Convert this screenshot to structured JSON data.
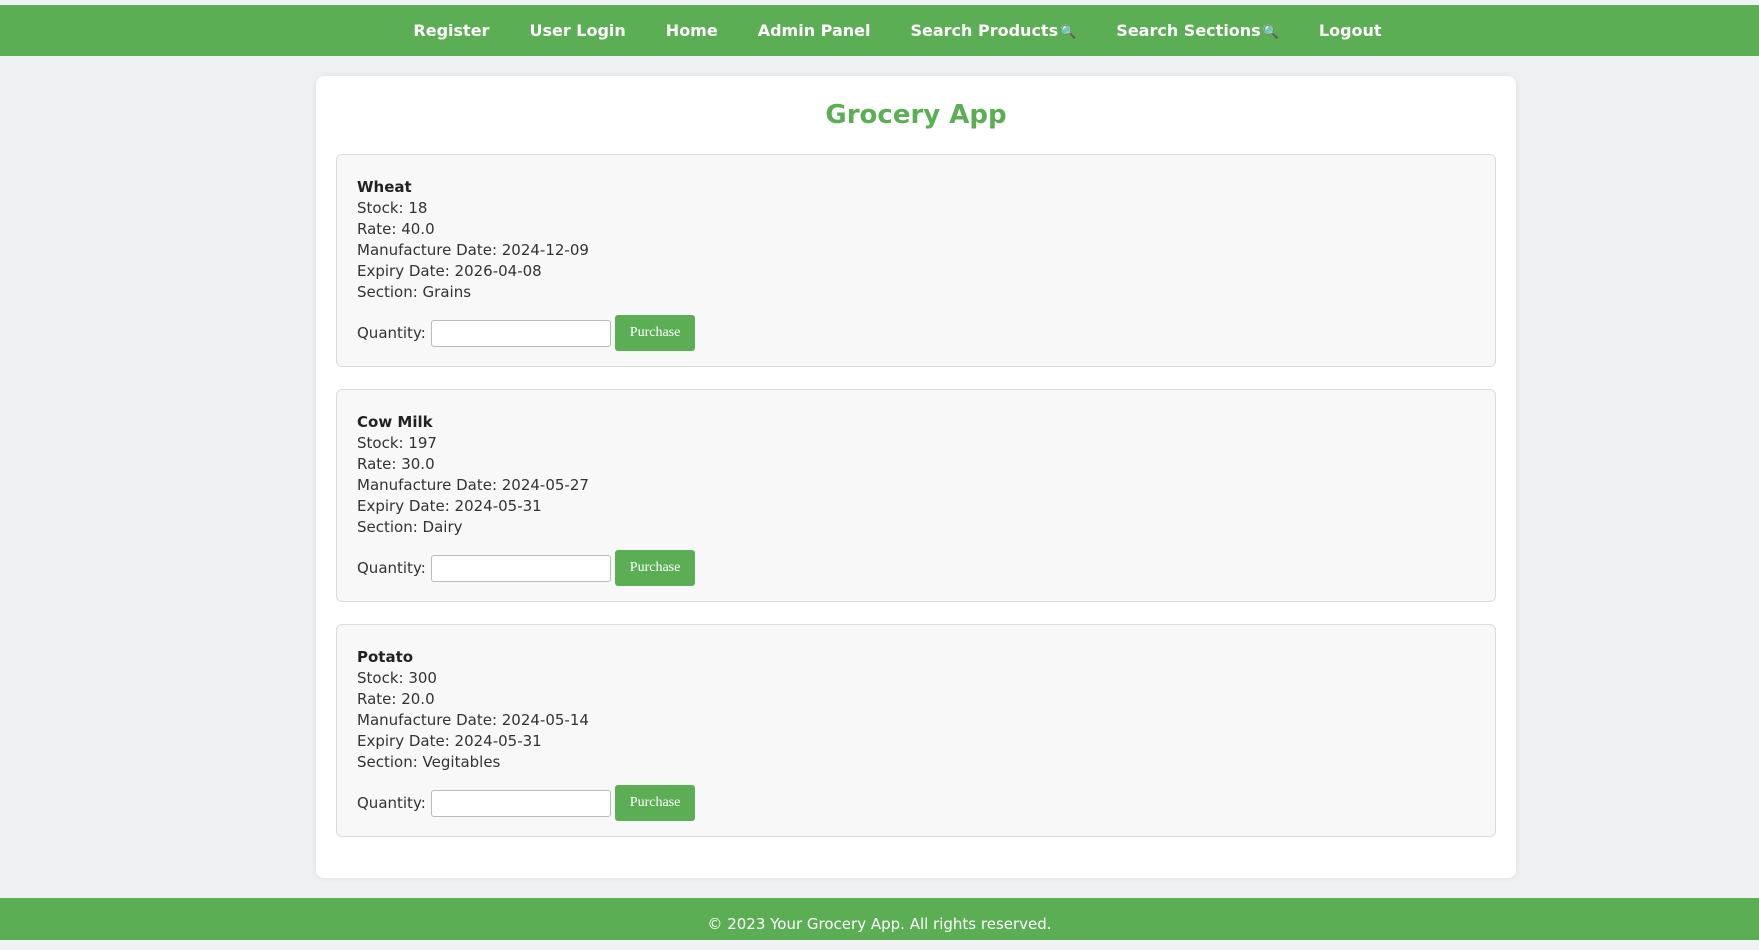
{
  "nav": {
    "items": [
      {
        "label": "Register"
      },
      {
        "label": "User Login"
      },
      {
        "label": "Home"
      },
      {
        "label": "Admin Panel"
      },
      {
        "label": "Search Products",
        "icon": "🔍"
      },
      {
        "label": "Search Sections",
        "icon": "🔍"
      },
      {
        "label": "Logout"
      }
    ]
  },
  "colors": {
    "brand": "#5cae55",
    "page_bg": "#f0f1f2",
    "card_bg": "#f8f8f8"
  },
  "page": {
    "title": "Grocery App"
  },
  "products": [
    {
      "name": "Wheat",
      "stock": "Stock: 18",
      "rate": "Rate: 40.0",
      "manufacture": "Manufacture Date: 2024-12-09",
      "expiry": "Expiry Date: 2026-04-08",
      "section": "Section: Grains",
      "quantity_label": "Quantity:",
      "quantity_value": "",
      "button_label": "Purchase"
    },
    {
      "name": "Cow Milk",
      "stock": "Stock: 197",
      "rate": "Rate: 30.0",
      "manufacture": "Manufacture Date: 2024-05-27",
      "expiry": "Expiry Date: 2024-05-31",
      "section": "Section: Dairy",
      "quantity_label": "Quantity:",
      "quantity_value": "",
      "button_label": "Purchase"
    },
    {
      "name": "Potato",
      "stock": "Stock: 300",
      "rate": "Rate: 20.0",
      "manufacture": "Manufacture Date: 2024-05-14",
      "expiry": "Expiry Date: 2024-05-31",
      "section": "Section: Vegitables",
      "quantity_label": "Quantity:",
      "quantity_value": "",
      "button_label": "Purchase"
    }
  ],
  "footer": {
    "text": "© 2023 Your Grocery App. All rights reserved."
  }
}
